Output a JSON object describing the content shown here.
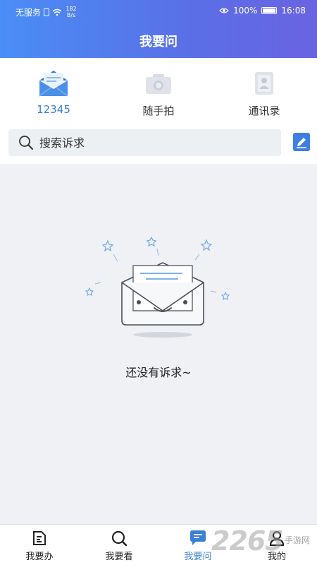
{
  "status_bar": {
    "carrier": "无服务",
    "net_speed_value": "182",
    "net_speed_unit": "B/s",
    "battery": "100%",
    "time": "16:08"
  },
  "header": {
    "title": "我要问"
  },
  "quick_actions": [
    {
      "label": "12345",
      "icon": "mail-icon",
      "active": true
    },
    {
      "label": "随手拍",
      "icon": "camera-icon",
      "active": false
    },
    {
      "label": "通讯录",
      "icon": "contacts-icon",
      "active": false
    }
  ],
  "search": {
    "placeholder": "搜索诉求"
  },
  "empty_state": {
    "message": "还没有诉求~"
  },
  "tab_bar": {
    "tabs": [
      {
        "label": "我要办",
        "icon": "document-icon",
        "active": false
      },
      {
        "label": "我要看",
        "icon": "search-icon",
        "active": false
      },
      {
        "label": "我要问",
        "icon": "chat-icon",
        "active": true
      },
      {
        "label": "我的",
        "icon": "person-icon",
        "active": false
      }
    ]
  },
  "watermark": {
    "number": "2265",
    "text": "手游网"
  },
  "colors": {
    "header_gradient_start": "#4a8df6",
    "header_gradient_end": "#6a63e2",
    "accent": "#3b7fd6",
    "content_background": "#eff1f4"
  }
}
